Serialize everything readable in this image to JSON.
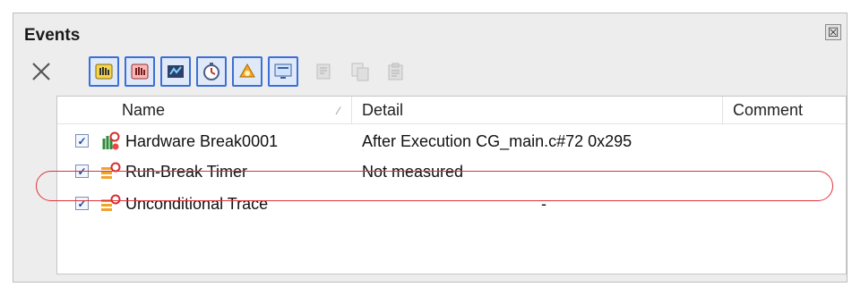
{
  "window": {
    "title": "Events",
    "close_glyph": "☒"
  },
  "toolbar": {
    "delete_icon": "close-x-icon",
    "enabled_buttons": [
      "hardware-break-icon",
      "software-break-icon",
      "trace-icon",
      "timer-icon",
      "performance-icon",
      "display-icon"
    ],
    "disabled_buttons": [
      "edit-disabled-icon",
      "copy-disabled-icon",
      "paste-disabled-icon"
    ]
  },
  "table": {
    "headers": {
      "name": "Name",
      "sort_indicator": "⁄",
      "detail": "Detail",
      "comment": "Comment"
    },
    "rows": [
      {
        "checked": "✓",
        "icon": "hardware-break-icon",
        "name": "Hardware Break0001",
        "detail": "After Execution  CG_main.c#72 0x295"
      },
      {
        "checked": "✓",
        "icon": "run-break-timer-icon",
        "name": "Run-Break Timer",
        "detail": "Not measured"
      },
      {
        "checked": "✓",
        "icon": "unconditional-trace-icon",
        "name": "Unconditional Trace",
        "detail": "-"
      }
    ]
  },
  "colors": {
    "highlight": "#e0323a",
    "button_border": "#3c6fd8"
  }
}
